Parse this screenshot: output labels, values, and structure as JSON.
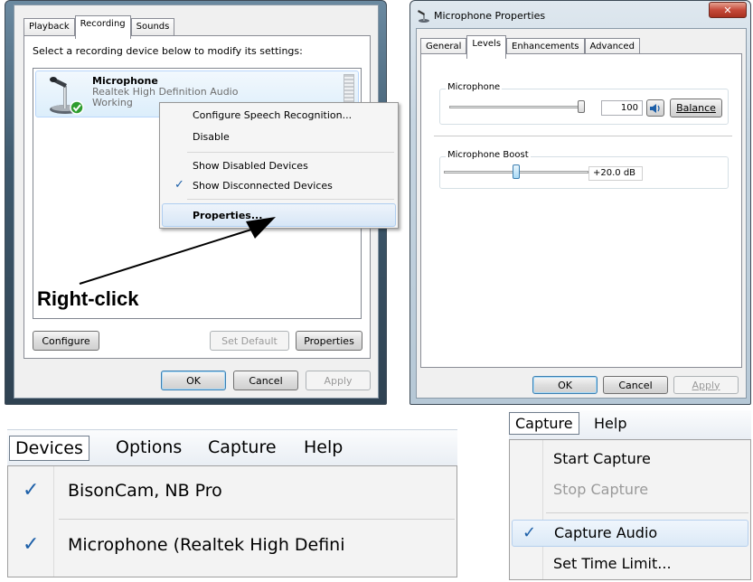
{
  "sound_dialog": {
    "tabs": [
      "Playback",
      "Recording",
      "Sounds"
    ],
    "active_tab": "Recording",
    "instruction": "Select a recording device below to modify its settings:",
    "device": {
      "name": "Microphone",
      "driver": "Realtek High Definition Audio",
      "status": "Working"
    },
    "buttons": {
      "configure": "Configure",
      "set_default": "Set Default",
      "properties": "Properties"
    },
    "footer": {
      "ok": "OK",
      "cancel": "Cancel",
      "apply": "Apply"
    }
  },
  "context_menu": {
    "items": [
      {
        "label": "Configure Speech Recognition...",
        "checked": false,
        "bold": false
      },
      {
        "label": "Disable",
        "checked": false,
        "bold": false
      },
      {
        "label": "Show Disabled Devices",
        "checked": false,
        "bold": false
      },
      {
        "label": "Show Disconnected Devices",
        "checked": true,
        "bold": false
      },
      {
        "label": "Properties...",
        "checked": false,
        "bold": true
      }
    ]
  },
  "annotation": {
    "label": "Right-click"
  },
  "mic_properties": {
    "title": "Microphone Properties",
    "tabs": [
      "General",
      "Levels",
      "Enhancements",
      "Advanced"
    ],
    "active_tab": "Levels",
    "microphone": {
      "label": "Microphone",
      "value": "100",
      "level": 1.0,
      "balance_label": "Balance"
    },
    "boost": {
      "label": "Microphone Boost",
      "value": "+20.0 dB",
      "level": 0.5
    },
    "footer": {
      "ok": "OK",
      "cancel": "Cancel",
      "apply": "Apply"
    }
  },
  "devices_menu": {
    "menubar": [
      "Devices",
      "Options",
      "Capture",
      "Help"
    ],
    "items": [
      {
        "label": "BisonCam, NB Pro",
        "checked": true
      },
      {
        "label": "Microphone (Realtek High Defini",
        "checked": true
      }
    ]
  },
  "capture_menu": {
    "menubar": [
      "Capture",
      "Help"
    ],
    "items": [
      {
        "label": "Start Capture",
        "checked": false,
        "disabled": false
      },
      {
        "label": "Stop Capture",
        "checked": false,
        "disabled": true
      },
      {
        "label": "Capture Audio",
        "checked": true,
        "disabled": false
      },
      {
        "label": "Set Time Limit...",
        "checked": false,
        "disabled": false
      }
    ]
  },
  "colors": {
    "window_frame": "#3f5a6e",
    "selection": "#d7e6f6",
    "check": "#1c5fa8",
    "close_red": "#c64a3a"
  }
}
